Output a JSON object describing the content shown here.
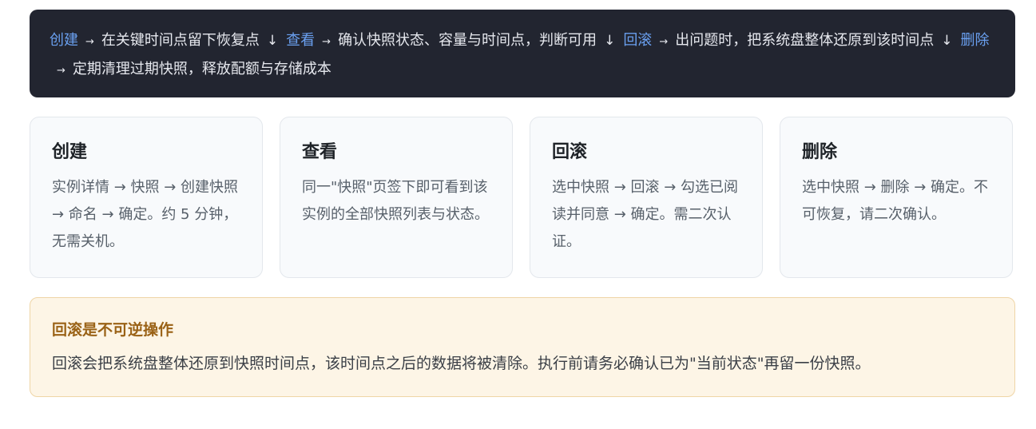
{
  "flow": {
    "steps": [
      {
        "label": "创建",
        "desc": "在关键时间点留下恢复点"
      },
      {
        "label": "查看",
        "desc": "确认快照状态、容量与时间点，判断可用"
      },
      {
        "label": "回滚",
        "desc": "出问题时，把系统盘整体还原到该时间点"
      },
      {
        "label": "删除",
        "desc": "定期清理过期快照，释放配额与存储成本"
      }
    ],
    "arrow": "→",
    "down": "↓"
  },
  "cards": [
    {
      "title": "创建",
      "desc": "实例详情 → 快照 → 创建快照 → 命名 → 确定。约 5 分钟，无需关机。"
    },
    {
      "title": "查看",
      "desc": "同一\"快照\"页签下即可看到该实例的全部快照列表与状态。"
    },
    {
      "title": "回滚",
      "desc": "选中快照 → 回滚 → 勾选已阅读并同意 → 确定。需二次认证。"
    },
    {
      "title": "删除",
      "desc": "选中快照 → 删除 → 确定。不可恢复，请二次确认。"
    }
  ],
  "warning": {
    "title": "回滚是不可逆操作",
    "text": "回滚会把系统盘整体还原到快照时间点，该时间点之后的数据将被清除。执行前请务必确认已为\"当前状态\"再留一份快照。"
  },
  "colors": {
    "banner_bg": "#222530",
    "step_link": "#6aa0f0",
    "card_bg": "#f8fafc",
    "warn_bg": "#fdf5e6",
    "warn_title": "#9a6216"
  }
}
